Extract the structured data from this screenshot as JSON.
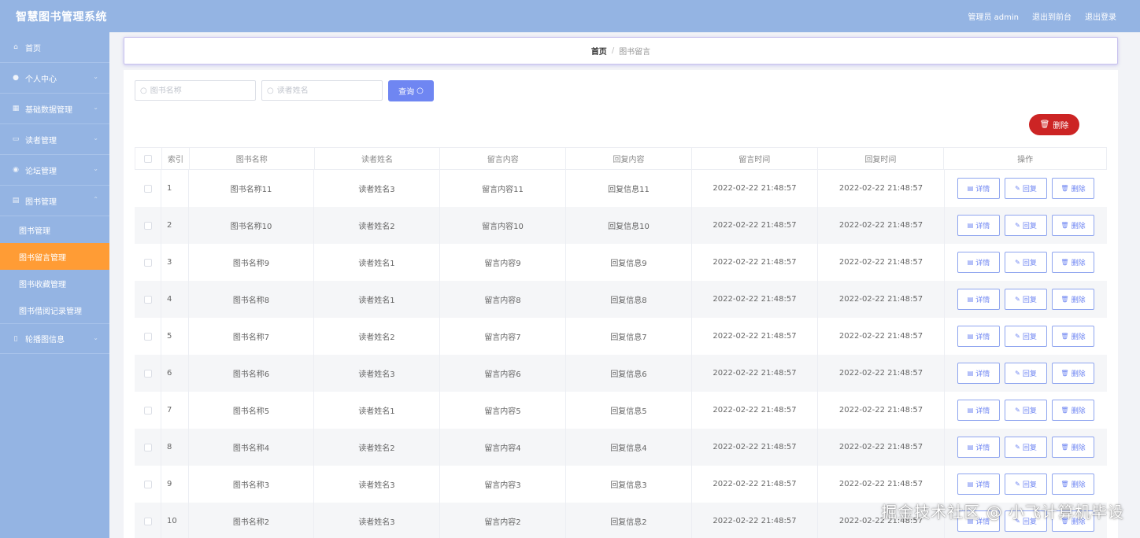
{
  "app": {
    "title": "智慧图书管理系统"
  },
  "top_links": {
    "user": "管理员 admin",
    "back": "退出到前台",
    "logout": "退出登录"
  },
  "sidebar": {
    "items": [
      {
        "label": "首页",
        "icon": "home-icon"
      },
      {
        "label": "个人中心",
        "icon": "user-icon"
      },
      {
        "label": "基础数据管理",
        "icon": "grid-icon"
      },
      {
        "label": "读者管理",
        "icon": "id-card-icon"
      },
      {
        "label": "论坛管理",
        "icon": "location-icon"
      },
      {
        "label": "图书管理",
        "icon": "book-icon"
      },
      {
        "label": "轮播图信息",
        "icon": "mobile-icon"
      }
    ],
    "subitems": [
      {
        "label": "图书管理"
      },
      {
        "label": "图书留言管理"
      },
      {
        "label": "图书收藏管理"
      },
      {
        "label": "图书借阅记录管理"
      }
    ]
  },
  "breadcrumb": {
    "home": "首页",
    "separator": "/",
    "current": "图书留言"
  },
  "search": {
    "book_placeholder": "图书名称",
    "reader_placeholder": "读者姓名",
    "query_label": "查询",
    "delete_label": "删除"
  },
  "table": {
    "columns": {
      "index": "索引",
      "book": "图书名称",
      "reader": "读者姓名",
      "message": "留言内容",
      "reply": "回复内容",
      "message_time": "留言时间",
      "reply_time": "回复时间",
      "ops": "操作"
    },
    "actions": {
      "detail": "详情",
      "reply": "回复",
      "delete": "删除"
    },
    "rows": [
      {
        "idx": "1",
        "book": "图书名称11",
        "reader": "读者姓名3",
        "message": "留言内容11",
        "reply": "回复信息11",
        "mtime": "2022-02-22 21:48:57",
        "rtime": "2022-02-22 21:48:57"
      },
      {
        "idx": "2",
        "book": "图书名称10",
        "reader": "读者姓名2",
        "message": "留言内容10",
        "reply": "回复信息10",
        "mtime": "2022-02-22 21:48:57",
        "rtime": "2022-02-22 21:48:57"
      },
      {
        "idx": "3",
        "book": "图书名称9",
        "reader": "读者姓名1",
        "message": "留言内容9",
        "reply": "回复信息9",
        "mtime": "2022-02-22 21:48:57",
        "rtime": "2022-02-22 21:48:57"
      },
      {
        "idx": "4",
        "book": "图书名称8",
        "reader": "读者姓名1",
        "message": "留言内容8",
        "reply": "回复信息8",
        "mtime": "2022-02-22 21:48:57",
        "rtime": "2022-02-22 21:48:57"
      },
      {
        "idx": "5",
        "book": "图书名称7",
        "reader": "读者姓名2",
        "message": "留言内容7",
        "reply": "回复信息7",
        "mtime": "2022-02-22 21:48:57",
        "rtime": "2022-02-22 21:48:57"
      },
      {
        "idx": "6",
        "book": "图书名称6",
        "reader": "读者姓名3",
        "message": "留言内容6",
        "reply": "回复信息6",
        "mtime": "2022-02-22 21:48:57",
        "rtime": "2022-02-22 21:48:57"
      },
      {
        "idx": "7",
        "book": "图书名称5",
        "reader": "读者姓名1",
        "message": "留言内容5",
        "reply": "回复信息5",
        "mtime": "2022-02-22 21:48:57",
        "rtime": "2022-02-22 21:48:57"
      },
      {
        "idx": "8",
        "book": "图书名称4",
        "reader": "读者姓名2",
        "message": "留言内容4",
        "reply": "回复信息4",
        "mtime": "2022-02-22 21:48:57",
        "rtime": "2022-02-22 21:48:57"
      },
      {
        "idx": "9",
        "book": "图书名称3",
        "reader": "读者姓名3",
        "message": "留言内容3",
        "reply": "回复信息3",
        "mtime": "2022-02-22 21:48:57",
        "rtime": "2022-02-22 21:48:57"
      },
      {
        "idx": "10",
        "book": "图书名称2",
        "reader": "读者姓名3",
        "message": "留言内容2",
        "reply": "回复信息2",
        "mtime": "2022-02-22 21:48:57",
        "rtime": "2022-02-22 21:48:57"
      }
    ]
  },
  "watermark": "掘金技术社区 @ 小飞计算机毕设"
}
